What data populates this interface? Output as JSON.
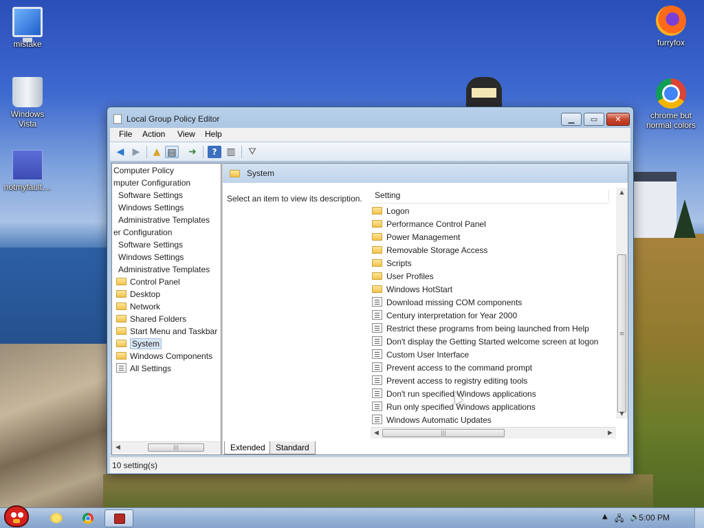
{
  "desktop": {
    "icons": [
      {
        "label": "mistake",
        "icon": "monitor-icon"
      },
      {
        "label": "Windows Vista",
        "icon": "recycle-bin-icon"
      },
      {
        "label": "notmyfault....",
        "icon": "thumbnail-icon"
      },
      {
        "label": "furryfox",
        "icon": "firefox-icon"
      },
      {
        "label": "chrome but normal colors",
        "icon": "chrome-icon"
      }
    ]
  },
  "window": {
    "title": "Local Group Policy Editor",
    "controls": {
      "minimize": "▁",
      "maximize": "▭",
      "close": "✕"
    },
    "menu": [
      "File",
      "Action",
      "View",
      "Help"
    ]
  },
  "tree": {
    "items": [
      {
        "label": "Computer Policy",
        "type": "text"
      },
      {
        "label": "mputer Configuration",
        "type": "text"
      },
      {
        "label": "Software Settings",
        "type": "text"
      },
      {
        "label": "Windows Settings",
        "type": "text"
      },
      {
        "label": "Administrative Templates",
        "type": "text"
      },
      {
        "label": "er Configuration",
        "type": "text"
      },
      {
        "label": "Software Settings",
        "type": "text"
      },
      {
        "label": "Windows Settings",
        "type": "text"
      },
      {
        "label": "Administrative Templates",
        "type": "text"
      },
      {
        "label": "Control Panel",
        "type": "folder"
      },
      {
        "label": "Desktop",
        "type": "folder"
      },
      {
        "label": "Network",
        "type": "folder"
      },
      {
        "label": "Shared Folders",
        "type": "folder"
      },
      {
        "label": "Start Menu and Taskbar",
        "type": "folder"
      },
      {
        "label": "System",
        "type": "folder",
        "selected": true
      },
      {
        "label": "Windows Components",
        "type": "folder"
      },
      {
        "label": "All Settings",
        "type": "settings"
      }
    ]
  },
  "details": {
    "header": "System",
    "description": "Select an item to view its description.",
    "column": "Setting",
    "rows": [
      {
        "label": "Logon",
        "type": "folder"
      },
      {
        "label": "Performance Control Panel",
        "type": "folder"
      },
      {
        "label": "Power Management",
        "type": "folder"
      },
      {
        "label": "Removable Storage Access",
        "type": "folder"
      },
      {
        "label": "Scripts",
        "type": "folder"
      },
      {
        "label": "User Profiles",
        "type": "folder"
      },
      {
        "label": "Windows HotStart",
        "type": "folder"
      },
      {
        "label": "Download missing COM components",
        "type": "setting"
      },
      {
        "label": "Century interpretation for Year 2000",
        "type": "setting"
      },
      {
        "label": "Restrict these programs from being launched from Help",
        "type": "setting"
      },
      {
        "label": "Don't display the Getting Started welcome screen at logon",
        "type": "setting"
      },
      {
        "label": "Custom User Interface",
        "type": "setting"
      },
      {
        "label": "Prevent access to the command prompt",
        "type": "setting"
      },
      {
        "label": "Prevent access to registry editing tools",
        "type": "setting"
      },
      {
        "label": "Don't run specified Windows applications",
        "type": "setting"
      },
      {
        "label": "Run only specified Windows applications",
        "type": "setting"
      },
      {
        "label": "Windows Automatic Updates",
        "type": "setting"
      }
    ],
    "tabs": [
      "Extended",
      "Standard"
    ]
  },
  "status": "10 setting(s)",
  "taskbar": {
    "clock": "5:00 PM"
  }
}
